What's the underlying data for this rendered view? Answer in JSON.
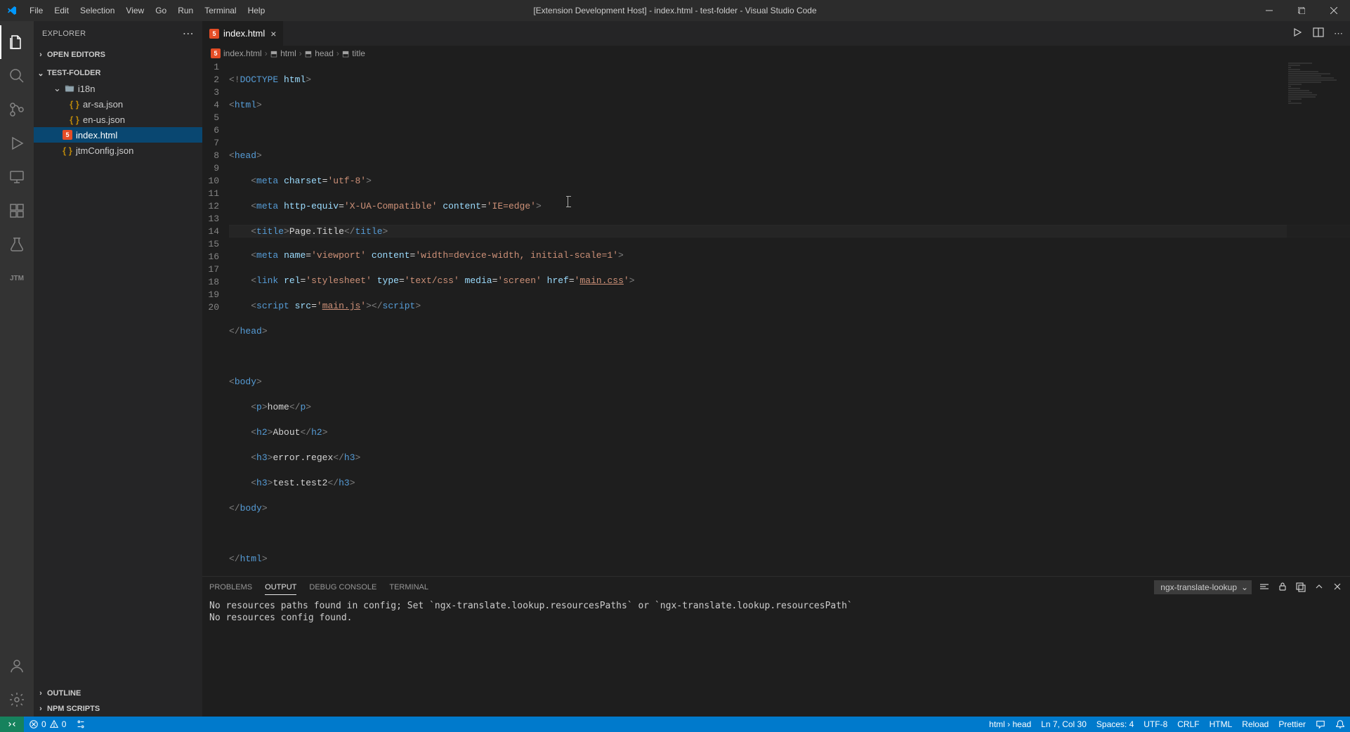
{
  "menubar": {
    "items": [
      "File",
      "Edit",
      "Selection",
      "View",
      "Go",
      "Run",
      "Terminal",
      "Help"
    ],
    "title": "[Extension Development Host] - index.html - test-folder - Visual Studio Code"
  },
  "sidebar": {
    "title": "EXPLORER",
    "sections": {
      "open_editors": "OPEN EDITORS",
      "folder": "TEST-FOLDER",
      "outline": "OUTLINE",
      "npm": "NPM SCRIPTS"
    },
    "tree": {
      "folder": {
        "name": "i18n"
      },
      "files": [
        {
          "name": "ar-sa.json",
          "type": "json"
        },
        {
          "name": "en-us.json",
          "type": "json"
        },
        {
          "name": "index.html",
          "type": "html",
          "selected": true
        },
        {
          "name": "jtmConfig.json",
          "type": "json"
        }
      ]
    }
  },
  "tab": {
    "name": "index.html"
  },
  "breadcrumb": {
    "file": "index.html",
    "parts": [
      "html",
      "head",
      "title"
    ]
  },
  "code": {
    "lines": 20
  },
  "panel": {
    "tabs": [
      "PROBLEMS",
      "OUTPUT",
      "DEBUG CONSOLE",
      "TERMINAL"
    ],
    "active": "OUTPUT",
    "dropdown": "ngx-translate-lookup",
    "output": [
      "No resources paths found in config; Set `ngx-translate.lookup.resourcesPaths` or `ngx-translate.lookup.resourcesPath`",
      "No resources config found."
    ]
  },
  "statusbar": {
    "errors": "0",
    "warnings": "0",
    "breadcrumb": "html › head",
    "ln_col": "Ln 7, Col 30",
    "spaces": "Spaces: 4",
    "encoding": "UTF-8",
    "eol": "CRLF",
    "lang": "HTML",
    "reload": "Reload",
    "prettier": "Prettier"
  }
}
